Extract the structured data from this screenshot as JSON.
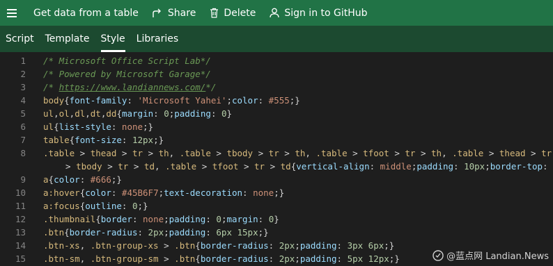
{
  "commandbar": {
    "items": [
      {
        "label": "Get data from a table"
      },
      {
        "label": "Share"
      },
      {
        "label": "Delete"
      },
      {
        "label": "Sign in to GitHub"
      }
    ]
  },
  "tabs": [
    {
      "label": "Script"
    },
    {
      "label": "Template"
    },
    {
      "label": "Style",
      "active": true
    },
    {
      "label": "Libraries"
    }
  ],
  "editor": {
    "lines": [
      {
        "n": "1",
        "tokens": [
          [
            "comment",
            "/* Microsoft Office Script Lab*/"
          ]
        ]
      },
      {
        "n": "2",
        "tokens": [
          [
            "comment",
            "/* Powered by Microsoft Garage*/"
          ]
        ]
      },
      {
        "n": "3",
        "tokens": [
          [
            "comment",
            "/* "
          ],
          [
            "link",
            "https://www.landiannews.com/"
          ],
          [
            "comment",
            "*/"
          ]
        ]
      },
      {
        "n": "4",
        "tokens": [
          [
            "tag",
            "body"
          ],
          [
            "punc",
            "{"
          ],
          [
            "prop",
            "font-family"
          ],
          [
            "punc",
            ": "
          ],
          [
            "str",
            "'Microsoft Yahei'"
          ],
          [
            "punc",
            ";"
          ],
          [
            "prop",
            "color"
          ],
          [
            "punc",
            ": "
          ],
          [
            "val",
            "#555"
          ],
          [
            "punc",
            ";}"
          ]
        ]
      },
      {
        "n": "5",
        "tokens": [
          [
            "tag",
            "ul"
          ],
          [
            "punc",
            ","
          ],
          [
            "tag",
            "ol"
          ],
          [
            "punc",
            ","
          ],
          [
            "tag",
            "dl"
          ],
          [
            "punc",
            ","
          ],
          [
            "tag",
            "dt"
          ],
          [
            "punc",
            ","
          ],
          [
            "tag",
            "dd"
          ],
          [
            "punc",
            "{"
          ],
          [
            "prop",
            "margin"
          ],
          [
            "punc",
            ": "
          ],
          [
            "num",
            "0"
          ],
          [
            "punc",
            ";"
          ],
          [
            "prop",
            "padding"
          ],
          [
            "punc",
            ": "
          ],
          [
            "num",
            "0"
          ],
          [
            "punc",
            "}"
          ]
        ]
      },
      {
        "n": "6",
        "tokens": [
          [
            "tag",
            "ul"
          ],
          [
            "punc",
            "{"
          ],
          [
            "prop",
            "list-style"
          ],
          [
            "punc",
            ": "
          ],
          [
            "val",
            "none"
          ],
          [
            "punc",
            ";}"
          ]
        ]
      },
      {
        "n": "7",
        "tokens": [
          [
            "tag",
            "table"
          ],
          [
            "punc",
            "{"
          ],
          [
            "prop",
            "font-size"
          ],
          [
            "punc",
            ": "
          ],
          [
            "num",
            "12px"
          ],
          [
            "punc",
            ";}"
          ]
        ]
      },
      {
        "n": "8",
        "tokens": [
          [
            "class",
            ".table"
          ],
          [
            "op",
            " > "
          ],
          [
            "tag",
            "thead"
          ],
          [
            "op",
            " > "
          ],
          [
            "tag",
            "tr"
          ],
          [
            "op",
            " > "
          ],
          [
            "tag",
            "th"
          ],
          [
            "punc",
            ", "
          ],
          [
            "class",
            ".table"
          ],
          [
            "op",
            " > "
          ],
          [
            "tag",
            "tbody"
          ],
          [
            "op",
            " > "
          ],
          [
            "tag",
            "tr"
          ],
          [
            "op",
            " > "
          ],
          [
            "tag",
            "th"
          ],
          [
            "punc",
            ", "
          ],
          [
            "class",
            ".table"
          ],
          [
            "op",
            " > "
          ],
          [
            "tag",
            "tfoot"
          ],
          [
            "op",
            " > "
          ],
          [
            "tag",
            "tr"
          ],
          [
            "op",
            " > "
          ],
          [
            "tag",
            "th"
          ],
          [
            "punc",
            ", "
          ],
          [
            "class",
            ".table"
          ],
          [
            "op",
            " > "
          ],
          [
            "tag",
            "thead"
          ],
          [
            "op",
            " > "
          ],
          [
            "tag",
            "tr"
          ]
        ]
      },
      {
        "n": "",
        "cont": true,
        "tokens": [
          [
            "op",
            "> "
          ],
          [
            "tag",
            "tbody"
          ],
          [
            "op",
            " > "
          ],
          [
            "tag",
            "tr"
          ],
          [
            "op",
            " > "
          ],
          [
            "tag",
            "td"
          ],
          [
            "punc",
            ", "
          ],
          [
            "class",
            ".table"
          ],
          [
            "op",
            " > "
          ],
          [
            "tag",
            "tfoot"
          ],
          [
            "op",
            " > "
          ],
          [
            "tag",
            "tr"
          ],
          [
            "op",
            " > "
          ],
          [
            "tag",
            "td"
          ],
          [
            "punc",
            "{"
          ],
          [
            "prop",
            "vertical-align"
          ],
          [
            "punc",
            ": "
          ],
          [
            "val",
            "middle"
          ],
          [
            "punc",
            ";"
          ],
          [
            "prop",
            "padding"
          ],
          [
            "punc",
            ": "
          ],
          [
            "num",
            "10px"
          ],
          [
            "punc",
            ";"
          ],
          [
            "prop",
            "border-top"
          ],
          [
            "punc",
            ": "
          ]
        ]
      },
      {
        "n": "9",
        "tokens": [
          [
            "tag",
            "a"
          ],
          [
            "punc",
            "{"
          ],
          [
            "prop",
            "color"
          ],
          [
            "punc",
            ": "
          ],
          [
            "val",
            "#666"
          ],
          [
            "punc",
            ";}"
          ]
        ]
      },
      {
        "n": "10",
        "tokens": [
          [
            "tag",
            "a"
          ],
          [
            "sel",
            ":hover"
          ],
          [
            "punc",
            "{"
          ],
          [
            "prop",
            "color"
          ],
          [
            "punc",
            ": "
          ],
          [
            "val",
            "#45B6F7"
          ],
          [
            "punc",
            ";"
          ],
          [
            "prop",
            "text-decoration"
          ],
          [
            "punc",
            ": "
          ],
          [
            "val",
            "none"
          ],
          [
            "punc",
            ";}"
          ]
        ]
      },
      {
        "n": "11",
        "tokens": [
          [
            "tag",
            "a"
          ],
          [
            "sel",
            ":focus"
          ],
          [
            "punc",
            "{"
          ],
          [
            "prop",
            "outline"
          ],
          [
            "punc",
            ": "
          ],
          [
            "num",
            "0"
          ],
          [
            "punc",
            ";}"
          ]
        ]
      },
      {
        "n": "12",
        "tokens": [
          [
            "class",
            ".thumbnail"
          ],
          [
            "punc",
            "{"
          ],
          [
            "prop",
            "border"
          ],
          [
            "punc",
            ": "
          ],
          [
            "val",
            "none"
          ],
          [
            "punc",
            ";"
          ],
          [
            "prop",
            "padding"
          ],
          [
            "punc",
            ": "
          ],
          [
            "num",
            "0"
          ],
          [
            "punc",
            ";"
          ],
          [
            "prop",
            "margin"
          ],
          [
            "punc",
            ": "
          ],
          [
            "num",
            "0"
          ],
          [
            "punc",
            "}"
          ]
        ]
      },
      {
        "n": "13",
        "tokens": [
          [
            "class",
            ".btn"
          ],
          [
            "punc",
            "{"
          ],
          [
            "prop",
            "border-radius"
          ],
          [
            "punc",
            ": "
          ],
          [
            "num",
            "2px"
          ],
          [
            "punc",
            ";"
          ],
          [
            "prop",
            "padding"
          ],
          [
            "punc",
            ": "
          ],
          [
            "num",
            "6px 15px"
          ],
          [
            "punc",
            ";}"
          ]
        ]
      },
      {
        "n": "14",
        "tokens": [
          [
            "class",
            ".btn-xs"
          ],
          [
            "punc",
            ", "
          ],
          [
            "class",
            ".btn-group-xs"
          ],
          [
            "op",
            " > "
          ],
          [
            "class",
            ".btn"
          ],
          [
            "punc",
            "{"
          ],
          [
            "prop",
            "border-radius"
          ],
          [
            "punc",
            ": "
          ],
          [
            "num",
            "2px"
          ],
          [
            "punc",
            ";"
          ],
          [
            "prop",
            "padding"
          ],
          [
            "punc",
            ": "
          ],
          [
            "num",
            "3px 6px"
          ],
          [
            "punc",
            ";}"
          ]
        ]
      },
      {
        "n": "15",
        "tokens": [
          [
            "class",
            ".btn-sm"
          ],
          [
            "punc",
            ", "
          ],
          [
            "class",
            ".btn-group-sm"
          ],
          [
            "op",
            " > "
          ],
          [
            "class",
            ".btn"
          ],
          [
            "punc",
            "{"
          ],
          [
            "prop",
            "border-radius"
          ],
          [
            "punc",
            ": "
          ],
          [
            "num",
            "2px"
          ],
          [
            "punc",
            ";"
          ],
          [
            "prop",
            "padding"
          ],
          [
            "punc",
            ": "
          ],
          [
            "num",
            "5px 12px"
          ],
          [
            "punc",
            ";}"
          ]
        ]
      }
    ]
  },
  "watermark": {
    "text": "@蓝点网 Landian.News"
  }
}
